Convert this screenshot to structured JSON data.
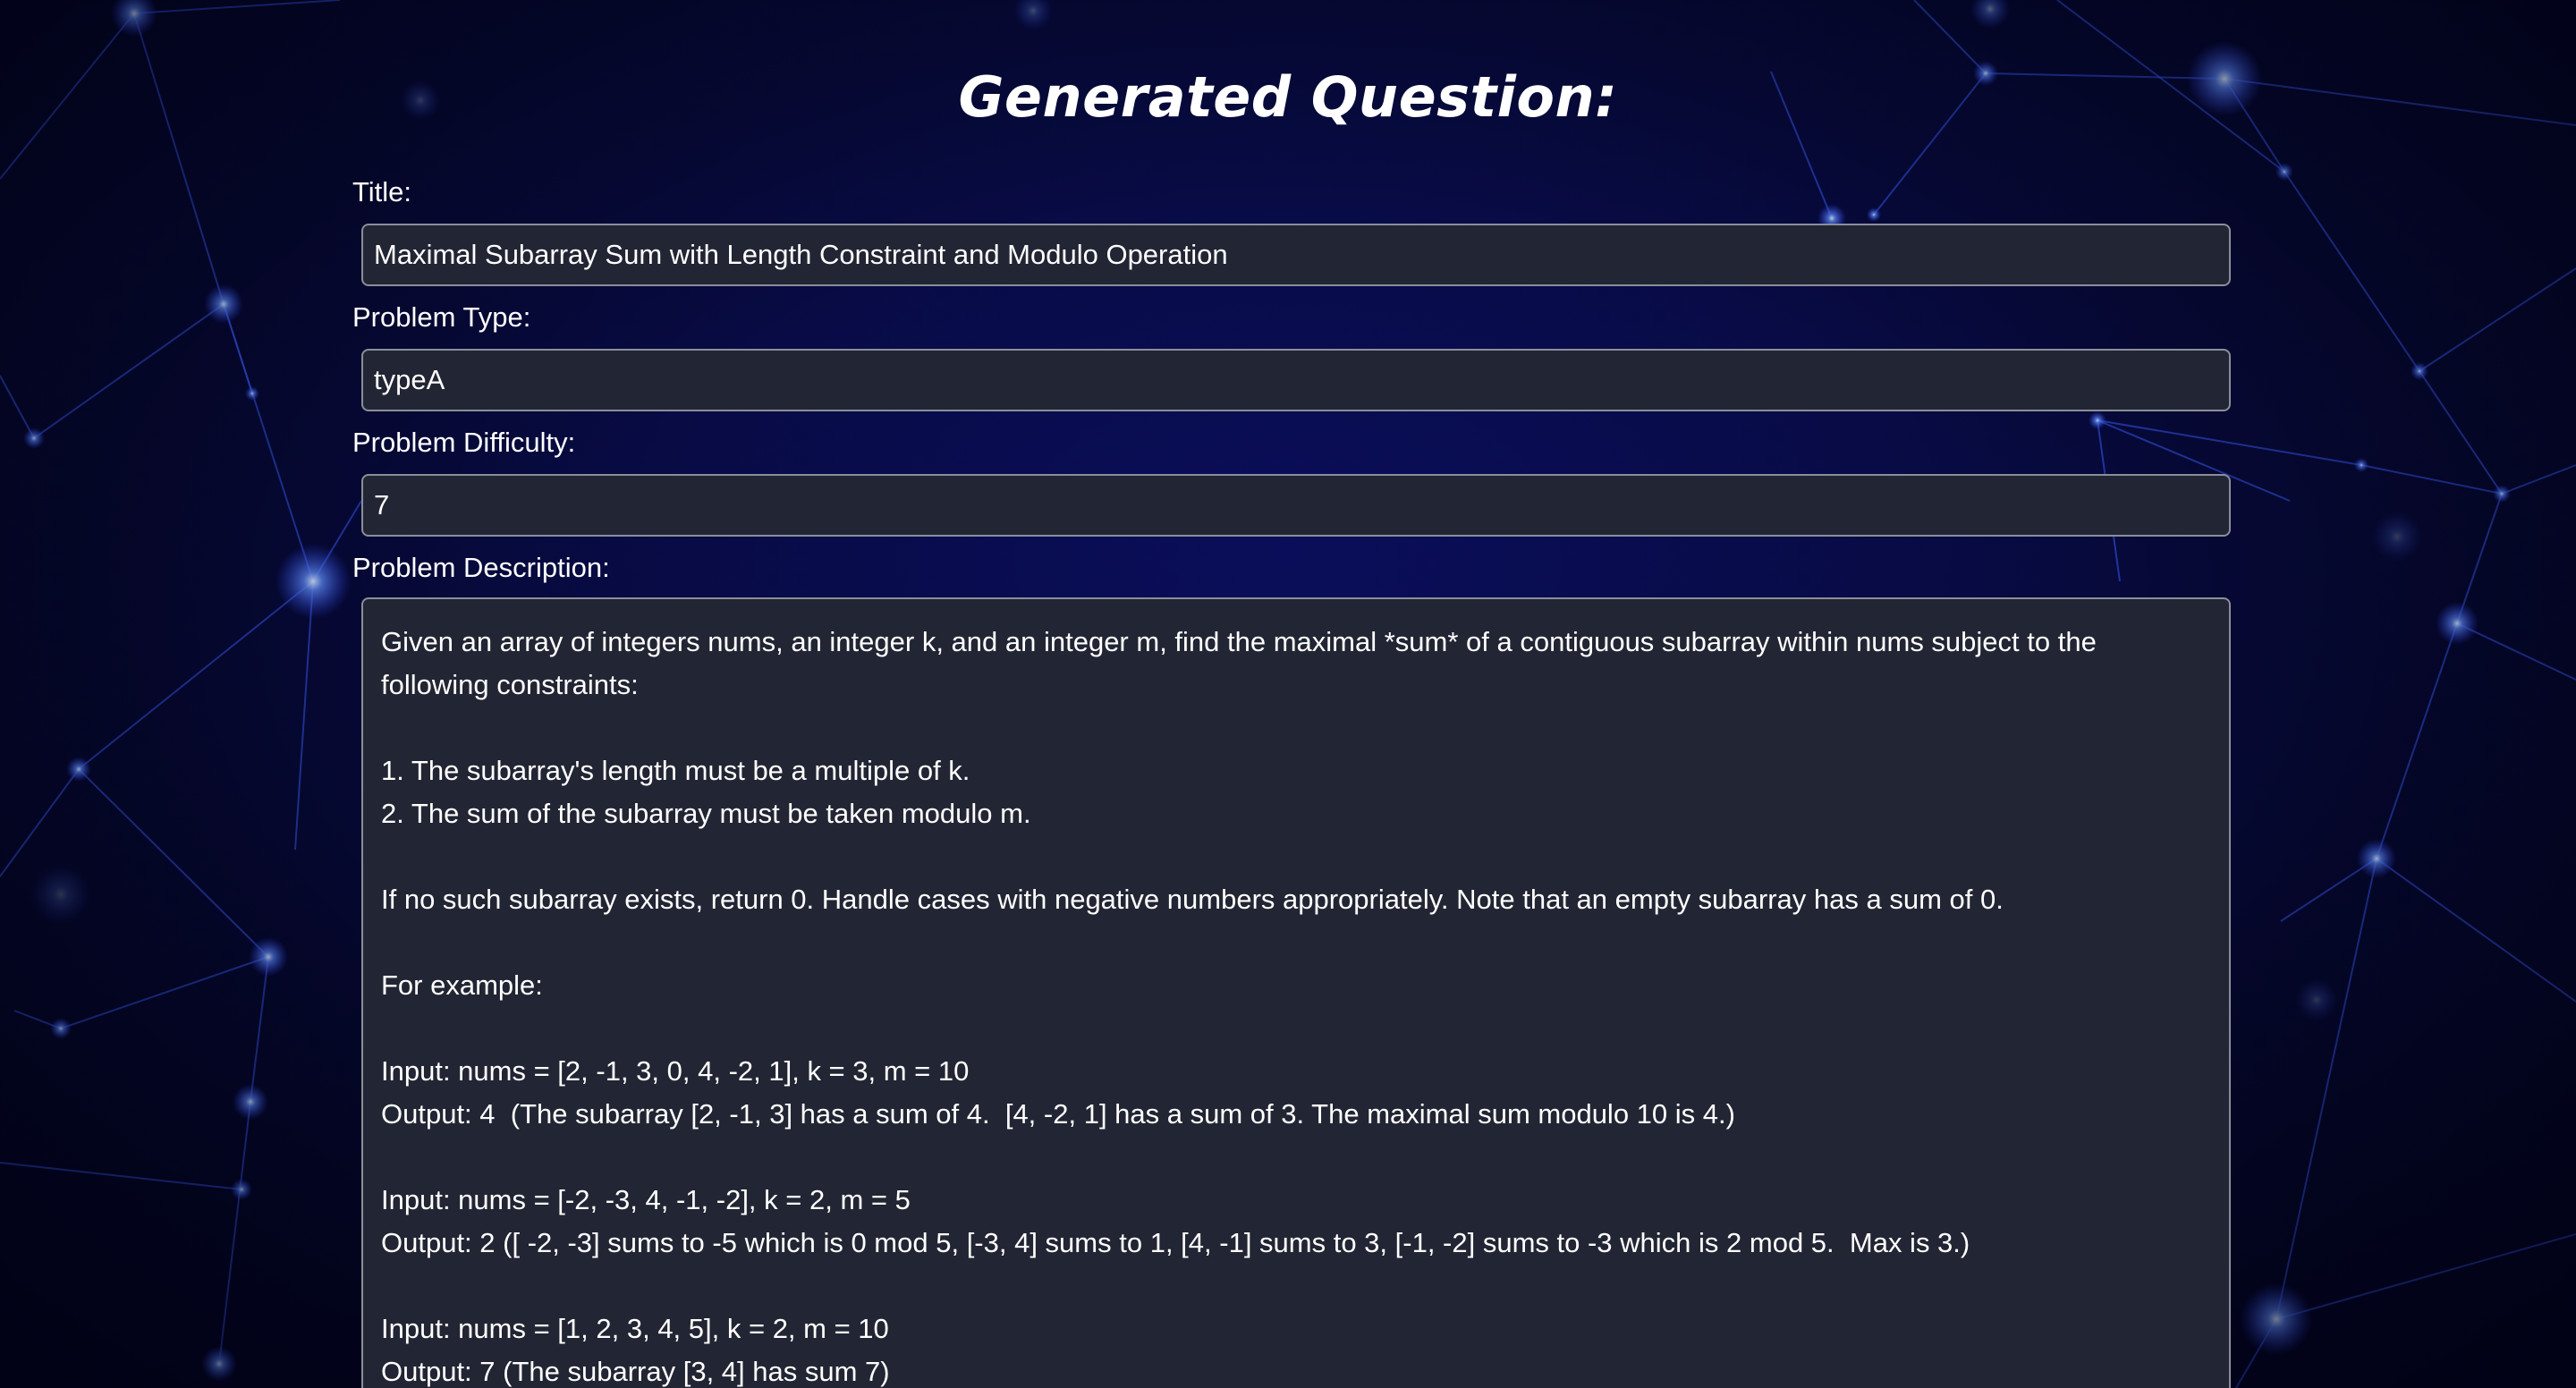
{
  "page": {
    "heading": "Generated Question:"
  },
  "form": {
    "title": {
      "label": "Title:",
      "value": "Maximal Subarray Sum with Length Constraint and Modulo Operation"
    },
    "problem_type": {
      "label": "Problem Type:",
      "value": "typeA"
    },
    "problem_difficulty": {
      "label": "Problem Difficulty:",
      "value": "7"
    },
    "problem_description": {
      "label": "Problem Description:",
      "value": "Given an array of integers nums, an integer k, and an integer m, find the maximal *sum* of a contiguous subarray within nums subject to the following constraints:\n\n1. The subarray's length must be a multiple of k.\n2. The sum of the subarray must be taken modulo m.\n\nIf no such subarray exists, return 0. Handle cases with negative numbers appropriately. Note that an empty subarray has a sum of 0.\n\nFor example:\n\nInput: nums = [2, -1, 3, 0, 4, -2, 1], k = 3, m = 10\nOutput: 4  (The subarray [2, -1, 3] has a sum of 4.  [4, -2, 1] has a sum of 3. The maximal sum modulo 10 is 4.)\n\nInput: nums = [-2, -3, 4, -1, -2], k = 2, m = 5\nOutput: 2 ([ -2, -3] sums to -5 which is 0 mod 5, [-3, 4] sums to 1, [4, -1] sums to 3, [-1, -2] sums to -3 which is 2 mod 5.  Max is 3.)\n\nInput: nums = [1, 2, 3, 4, 5], k = 2, m = 10\nOutput: 7 (The subarray [3, 4] has sum 7)"
    }
  },
  "colors": {
    "background": "#070a3e",
    "field_background": "#222533",
    "field_border": "#8b8e9a",
    "text": "#ffffff",
    "network_lines": "#3a5cff"
  }
}
